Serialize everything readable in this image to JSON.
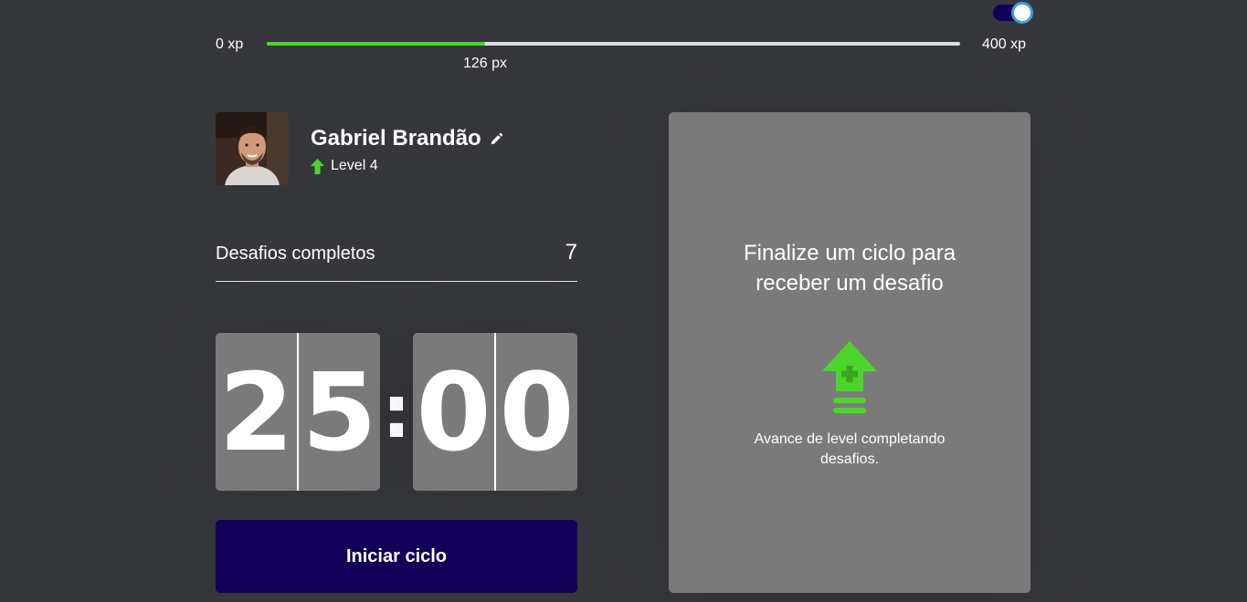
{
  "theme_toggle": {
    "on": true
  },
  "experience": {
    "min_label": "0 xp",
    "max_label": "400 xp",
    "current_label": "126 px",
    "progress_fraction": 0.315,
    "bar_color": "#4cd62b"
  },
  "profile": {
    "name": "Gabriel Brandão",
    "level_label": "Level 4",
    "edit_icon": "pencil-icon",
    "level_icon": "level-up-arrow-icon"
  },
  "completed_challenges": {
    "label": "Desafios completos",
    "count": "7"
  },
  "countdown": {
    "minute_left": "2",
    "minute_right": "5",
    "separator": ":",
    "second_left": "0",
    "second_right": "0"
  },
  "start_button": {
    "label": "Iniciar ciclo",
    "color": "#120058"
  },
  "challenge_box": {
    "title": "Finalize um ciclo para receber um desafio",
    "icon": "level-up-icon",
    "hint": "Avance de level completando desafios."
  },
  "colors": {
    "background": "#36373b",
    "card": "#7b7a7b",
    "accent_green": "#4cd62b",
    "toggle_blue": "#3f9bd8"
  }
}
